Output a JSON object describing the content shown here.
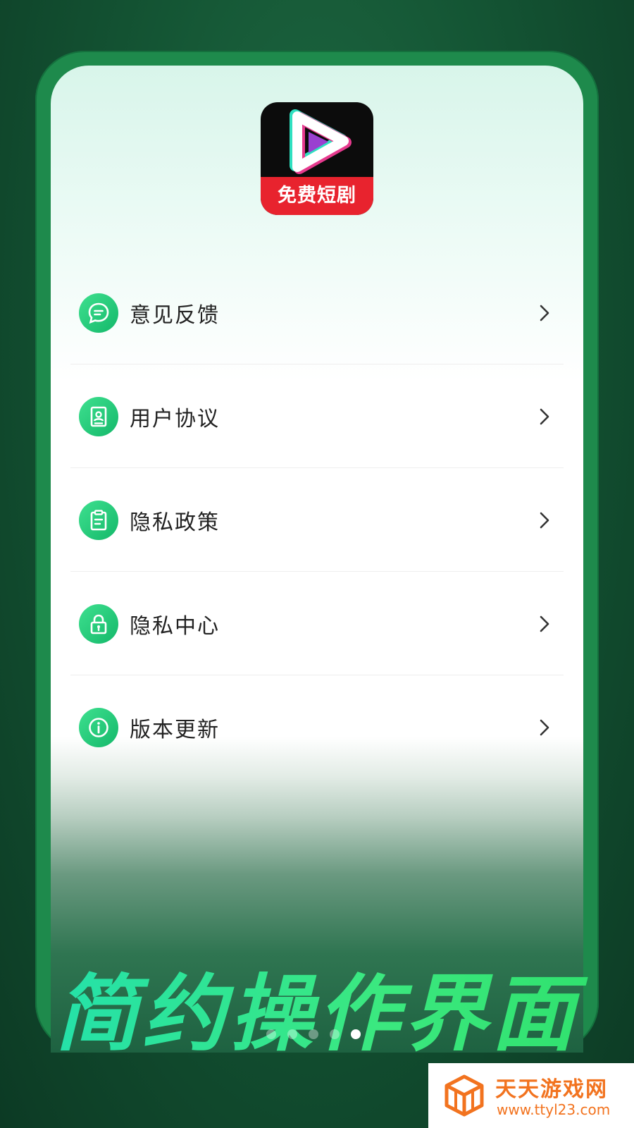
{
  "app": {
    "logo_icon": "play-icon",
    "logo_text": "免费短剧"
  },
  "menu": {
    "items": [
      {
        "label": "意见反馈",
        "icon": "chat-bubble-icon"
      },
      {
        "label": "用户协议",
        "icon": "document-person-icon"
      },
      {
        "label": "隐私政策",
        "icon": "clipboard-icon"
      },
      {
        "label": "隐私中心",
        "icon": "lock-icon"
      },
      {
        "label": "版本更新",
        "icon": "info-icon"
      }
    ],
    "chevron_icon": "chevron-right-icon"
  },
  "slogan": "简约操作界面",
  "pagination": {
    "total": 5,
    "active_index": 4
  },
  "watermark": {
    "title": "天天游戏网",
    "url": "www.ttyl23.com"
  },
  "colors": {
    "accent_green": "#1ec774",
    "logo_red": "#e8232e",
    "watermark_orange": "#f2731f"
  }
}
